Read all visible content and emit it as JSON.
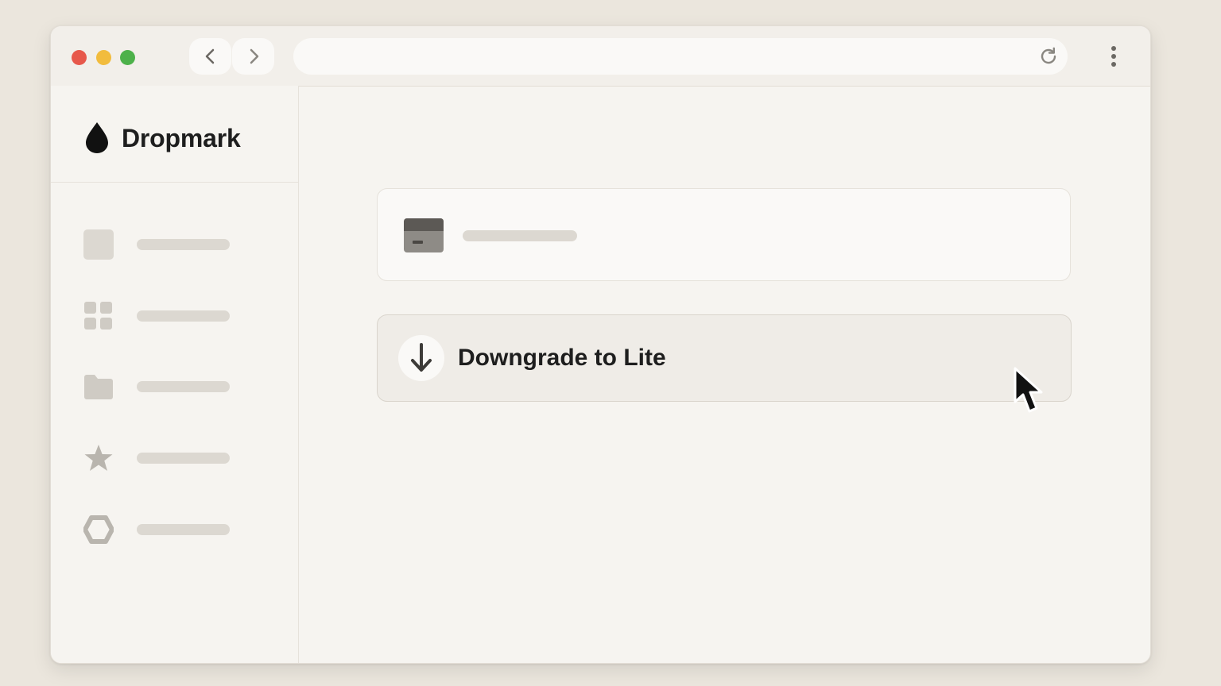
{
  "window": {
    "controls": [
      "close",
      "minimize",
      "maximize"
    ],
    "colors": {
      "close": "#e7584b",
      "minimize": "#f2bc3d",
      "maximize": "#4db14a"
    }
  },
  "toolbar": {
    "back_icon": "chevron-left-icon",
    "forward_icon": "chevron-right-icon",
    "address": "",
    "reload_icon": "reload-icon",
    "menu_icon": "kebab-menu-icon"
  },
  "sidebar": {
    "brand": {
      "name": "Dropmark",
      "logo_icon": "droplet-icon"
    },
    "items": [
      {
        "icon": "square-icon",
        "label": ""
      },
      {
        "icon": "grid-icon",
        "label": ""
      },
      {
        "icon": "folder-icon",
        "label": ""
      },
      {
        "icon": "star-icon",
        "label": ""
      },
      {
        "icon": "hexagon-icon",
        "label": ""
      }
    ]
  },
  "main": {
    "billing_card": {
      "icon": "credit-card-icon",
      "label": ""
    },
    "downgrade_button": {
      "icon": "arrow-down-icon",
      "label": "Downgrade to Lite"
    }
  },
  "colors": {
    "background": "#ebe6dd",
    "surface": "#f6f4f0",
    "placeholder": "#dcd8d1",
    "text": "#1e1e1e"
  }
}
